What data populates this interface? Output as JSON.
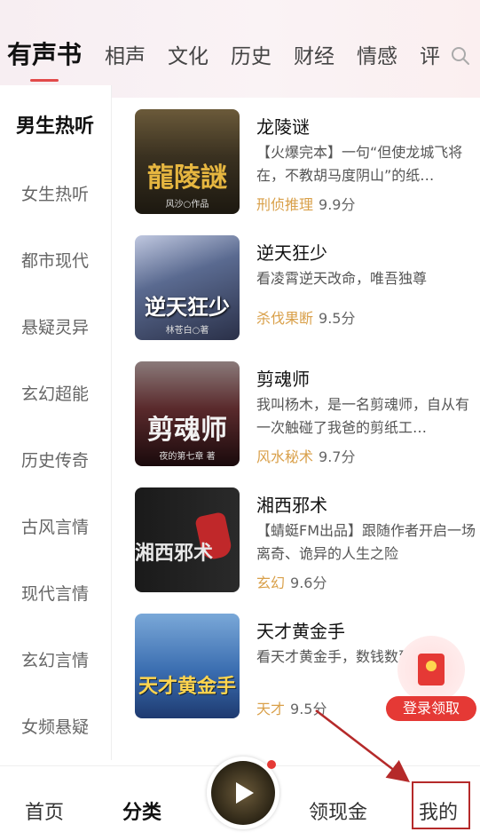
{
  "tabs": [
    "有声书",
    "相声",
    "文化",
    "历史",
    "财经",
    "情感",
    "评"
  ],
  "categories": [
    "男生热听",
    "女生热听",
    "都市现代",
    "悬疑灵异",
    "玄幻超能",
    "历史传奇",
    "古风言情",
    "现代言情",
    "玄幻言情",
    "女频悬疑"
  ],
  "books": [
    {
      "title": "龙陵谜",
      "desc": "【火爆完本】一句“但使龙城飞将在，不教胡马度阴山”的纸…",
      "tag": "刑侦推理",
      "score": "9.9分",
      "cover_text": "龍陵謎",
      "cover_author": "风沙○作品",
      "cover_color": "#2a2414"
    },
    {
      "title": "逆天狂少",
      "desc": "看凌霄逆天改命，唯吾独尊",
      "tag": "杀伐果断",
      "score": "9.5分",
      "cover_text": "逆天狂少",
      "cover_author": "林苍白○著",
      "cover_color": "#3e4a6a"
    },
    {
      "title": "剪魂师",
      "desc": "我叫杨木，是一名剪魂师，自从有一次触碰了我爸的剪纸工…",
      "tag": "风水秘术",
      "score": "9.7分",
      "cover_text": "剪魂师",
      "cover_author": "夜的第七章 著",
      "cover_color": "#3a1a1c"
    },
    {
      "title": "湘西邪术",
      "desc": "【蜻蜓FM出品】跟随作者开启一场离奇、诡异的人生之险",
      "tag": "玄幻",
      "score": "9.6分",
      "cover_text": "湘西邪术",
      "cover_author": "",
      "cover_color": "#1a1a1a"
    },
    {
      "title": "天才黄金手",
      "desc": "看天才黄金手，数钱数到手抽筋",
      "tag": "天才",
      "score": "9.5分",
      "cover_text": "天才黄金手",
      "cover_author": "",
      "cover_color": "#3a6db0"
    }
  ],
  "bottom_nav": {
    "home": "首页",
    "category": "分类",
    "cash": "领现金",
    "mine": "我的"
  },
  "login_badge": "登录领取",
  "colors": {
    "accent": "#e53935",
    "tag": "#d9a04a",
    "highlight": "#b52a2a"
  }
}
